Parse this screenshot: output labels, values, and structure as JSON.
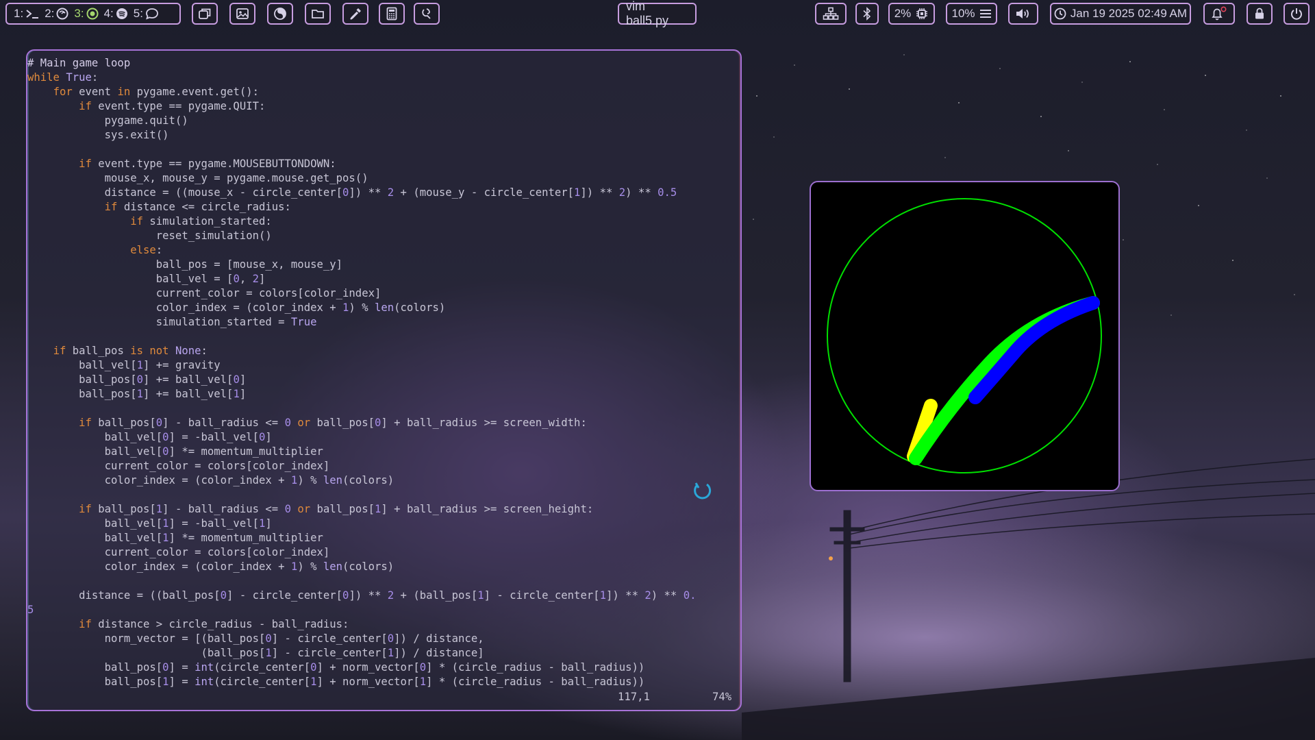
{
  "topbar": {
    "workspaces": [
      {
        "number": "1:",
        "icon": "terminal-icon"
      },
      {
        "number": "2:",
        "icon": "firefox-icon"
      },
      {
        "number": "3:",
        "icon": "radio-target-icon",
        "active": true
      },
      {
        "number": "4:",
        "icon": "spotify-icon"
      },
      {
        "number": "5:",
        "icon": "chat-bubble-icon"
      }
    ],
    "launchers": [
      "windows-icon",
      "image-icon",
      "theme-icon",
      "folder-icon",
      "color-picker-icon",
      "calculator-icon",
      "settings-icon"
    ],
    "window_title": "vim ball5.py",
    "cpu": "2%",
    "memory": "10%",
    "datetime": "Jan 19 2025 02:49 AM",
    "right_icons": [
      "network-icon",
      "bluetooth-icon",
      "volume-icon",
      "notification-bell-icon",
      "lock-icon",
      "power-icon"
    ]
  },
  "editor": {
    "line_position": "117,1",
    "scroll_percent": "74%",
    "lines": [
      [
        [
          "# Main game loop",
          "cm"
        ]
      ],
      [
        [
          "while",
          "kw"
        ],
        [
          " ",
          ""
        ],
        [
          "True",
          "bi"
        ],
        [
          ":",
          ""
        ]
      ],
      [
        [
          "    ",
          ""
        ],
        [
          "for",
          "kw"
        ],
        [
          " event ",
          ""
        ],
        [
          "in",
          "kw"
        ],
        [
          " pygame.event.get():",
          ""
        ]
      ],
      [
        [
          "        ",
          ""
        ],
        [
          "if",
          "kw"
        ],
        [
          " event.type == pygame.QUIT:",
          ""
        ]
      ],
      [
        [
          "            pygame.quit()",
          ""
        ]
      ],
      [
        [
          "            sys.exit()",
          ""
        ]
      ],
      [
        [
          "",
          ""
        ]
      ],
      [
        [
          "        ",
          ""
        ],
        [
          "if",
          "kw"
        ],
        [
          " event.type == pygame.MOUSEBUTTONDOWN:",
          ""
        ]
      ],
      [
        [
          "            mouse_x, mouse_y = pygame.mouse.get_pos()",
          ""
        ]
      ],
      [
        [
          "            distance = ((mouse_x - circle_center[",
          ""
        ],
        [
          "0",
          "nm"
        ],
        [
          "]) ** ",
          ""
        ],
        [
          "2",
          "nm"
        ],
        [
          " + (mouse_y - circle_center[",
          ""
        ],
        [
          "1",
          "nm"
        ],
        [
          "]) ** ",
          ""
        ],
        [
          "2",
          "nm"
        ],
        [
          ") ** ",
          ""
        ],
        [
          "0.5",
          "nm"
        ]
      ],
      [
        [
          "            ",
          ""
        ],
        [
          "if",
          "kw"
        ],
        [
          " distance <= circle_radius:",
          ""
        ]
      ],
      [
        [
          "                ",
          ""
        ],
        [
          "if",
          "kw"
        ],
        [
          " simulation_started:",
          ""
        ]
      ],
      [
        [
          "                    reset_simulation()",
          ""
        ]
      ],
      [
        [
          "                ",
          ""
        ],
        [
          "else",
          "kw"
        ],
        [
          ":",
          ""
        ]
      ],
      [
        [
          "                    ball_pos = [mouse_x, mouse_y]",
          ""
        ]
      ],
      [
        [
          "                    ball_vel = [",
          ""
        ],
        [
          "0",
          "nm"
        ],
        [
          ", ",
          ""
        ],
        [
          "2",
          "nm"
        ],
        [
          "]",
          ""
        ]
      ],
      [
        [
          "                    current_color = colors[color_index]",
          ""
        ]
      ],
      [
        [
          "                    color_index = (color_index + ",
          ""
        ],
        [
          "1",
          "nm"
        ],
        [
          ") % ",
          ""
        ],
        [
          "len",
          "bi"
        ],
        [
          "(colors)",
          ""
        ]
      ],
      [
        [
          "                    simulation_started = ",
          ""
        ],
        [
          "True",
          "bi"
        ]
      ],
      [
        [
          "",
          ""
        ]
      ],
      [
        [
          "    ",
          ""
        ],
        [
          "if",
          "kw"
        ],
        [
          " ball_pos ",
          ""
        ],
        [
          "is not",
          "kw"
        ],
        [
          " ",
          ""
        ],
        [
          "None",
          "bi"
        ],
        [
          ":",
          ""
        ]
      ],
      [
        [
          "        ball_vel[",
          ""
        ],
        [
          "1",
          "nm"
        ],
        [
          "] += gravity",
          ""
        ]
      ],
      [
        [
          "        ball_pos[",
          ""
        ],
        [
          "0",
          "nm"
        ],
        [
          "] += ball_vel[",
          ""
        ],
        [
          "0",
          "nm"
        ],
        [
          "]",
          ""
        ]
      ],
      [
        [
          "        ball_pos[",
          ""
        ],
        [
          "1",
          "nm"
        ],
        [
          "] += ball_vel[",
          ""
        ],
        [
          "1",
          "nm"
        ],
        [
          "]",
          ""
        ]
      ],
      [
        [
          "",
          ""
        ]
      ],
      [
        [
          "        ",
          ""
        ],
        [
          "if",
          "kw"
        ],
        [
          " ball_pos[",
          ""
        ],
        [
          "0",
          "nm"
        ],
        [
          "] - ball_radius <= ",
          ""
        ],
        [
          "0",
          "nm"
        ],
        [
          " ",
          ""
        ],
        [
          "or",
          "kw"
        ],
        [
          " ball_pos[",
          ""
        ],
        [
          "0",
          "nm"
        ],
        [
          "] + ball_radius >= screen_width:",
          ""
        ]
      ],
      [
        [
          "            ball_vel[",
          ""
        ],
        [
          "0",
          "nm"
        ],
        [
          "] = -ball_vel[",
          ""
        ],
        [
          "0",
          "nm"
        ],
        [
          "]",
          ""
        ]
      ],
      [
        [
          "            ball_vel[",
          ""
        ],
        [
          "0",
          "nm"
        ],
        [
          "] *= momentum_multiplier",
          ""
        ]
      ],
      [
        [
          "            current_color = colors[color_index]",
          ""
        ]
      ],
      [
        [
          "            color_index = (color_index + ",
          ""
        ],
        [
          "1",
          "nm"
        ],
        [
          ") % ",
          ""
        ],
        [
          "len",
          "bi"
        ],
        [
          "(colors)",
          ""
        ]
      ],
      [
        [
          "",
          ""
        ]
      ],
      [
        [
          "        ",
          ""
        ],
        [
          "if",
          "kw"
        ],
        [
          " ball_pos[",
          ""
        ],
        [
          "1",
          "nm"
        ],
        [
          "] - ball_radius <= ",
          ""
        ],
        [
          "0",
          "nm"
        ],
        [
          " ",
          ""
        ],
        [
          "or",
          "kw"
        ],
        [
          " ball_pos[",
          ""
        ],
        [
          "1",
          "nm"
        ],
        [
          "] + ball_radius >= screen_height:",
          ""
        ]
      ],
      [
        [
          "            ball_vel[",
          ""
        ],
        [
          "1",
          "nm"
        ],
        [
          "] = -ball_vel[",
          ""
        ],
        [
          "1",
          "nm"
        ],
        [
          "]",
          ""
        ]
      ],
      [
        [
          "            ball_vel[",
          ""
        ],
        [
          "1",
          "nm"
        ],
        [
          "] *= momentum_multiplier",
          ""
        ]
      ],
      [
        [
          "            current_color = colors[color_index]",
          ""
        ]
      ],
      [
        [
          "            color_index = (color_index + ",
          ""
        ],
        [
          "1",
          "nm"
        ],
        [
          ") % ",
          ""
        ],
        [
          "len",
          "bi"
        ],
        [
          "(colors)",
          ""
        ]
      ],
      [
        [
          "",
          ""
        ]
      ],
      [
        [
          "        distance = ((ball_pos[",
          ""
        ],
        [
          "0",
          "nm"
        ],
        [
          "] - circle_center[",
          ""
        ],
        [
          "0",
          "nm"
        ],
        [
          "]) ** ",
          ""
        ],
        [
          "2",
          "nm"
        ],
        [
          " + (ball_pos[",
          ""
        ],
        [
          "1",
          "nm"
        ],
        [
          "] - circle_center[",
          ""
        ],
        [
          "1",
          "nm"
        ],
        [
          "]) ** ",
          ""
        ],
        [
          "2",
          "nm"
        ],
        [
          ") ** ",
          ""
        ],
        [
          "0.",
          "nm"
        ]
      ],
      [
        [
          "5",
          "nm"
        ]
      ],
      [
        [
          "        ",
          ""
        ],
        [
          "if",
          "kw"
        ],
        [
          " distance > circle_radius - ball_radius:",
          ""
        ]
      ],
      [
        [
          "            norm_vector = [(ball_pos[",
          ""
        ],
        [
          "0",
          "nm"
        ],
        [
          "] - circle_center[",
          ""
        ],
        [
          "0",
          "nm"
        ],
        [
          "]) / distance,",
          ""
        ]
      ],
      [
        [
          "                           (ball_pos[",
          ""
        ],
        [
          "1",
          "nm"
        ],
        [
          "] - circle_center[",
          ""
        ],
        [
          "1",
          "nm"
        ],
        [
          "]) / distance]",
          ""
        ]
      ],
      [
        [
          "            ball_pos[",
          ""
        ],
        [
          "0",
          "nm"
        ],
        [
          "] = ",
          ""
        ],
        [
          "int",
          "bi"
        ],
        [
          "(circle_center[",
          ""
        ],
        [
          "0",
          "nm"
        ],
        [
          "] + norm_vector[",
          ""
        ],
        [
          "0",
          "nm"
        ],
        [
          "] * (circle_radius - ball_radius))",
          ""
        ]
      ],
      [
        [
          "            ball_pos[",
          ""
        ],
        [
          "1",
          "nm"
        ],
        [
          "] = ",
          ""
        ],
        [
          "int",
          "bi"
        ],
        [
          "(circle_center[",
          ""
        ],
        [
          "1",
          "nm"
        ],
        [
          "] + norm_vector[",
          ""
        ],
        [
          "1",
          "nm"
        ],
        [
          "] * (circle_radius - ball_radius))",
          ""
        ]
      ]
    ]
  },
  "game": {
    "circle_color": "#00e000",
    "trail_colors": [
      "#ffff00",
      "#00ff00",
      "#0000ff"
    ]
  }
}
